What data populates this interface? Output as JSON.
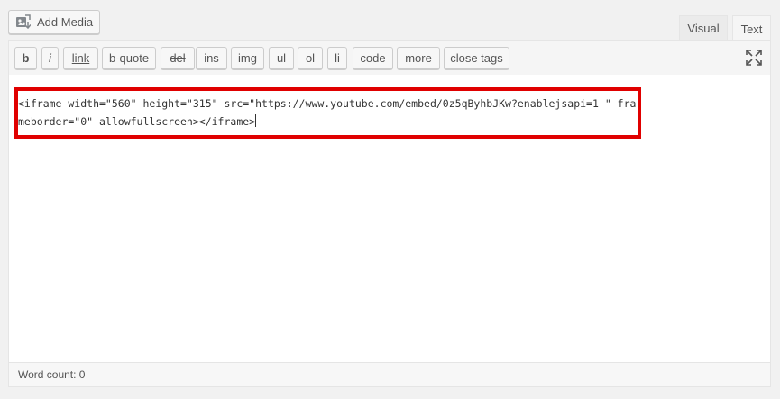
{
  "media": {
    "add_label": "Add Media"
  },
  "tabs": {
    "visual": "Visual",
    "text": "Text"
  },
  "toolbar": {
    "buttons": [
      "b",
      "i",
      "link",
      "b-quote",
      "del",
      "ins",
      "img",
      "ul",
      "ol",
      "li",
      "code",
      "more",
      "close tags"
    ]
  },
  "editor": {
    "content": "<iframe width=\"560\" height=\"315\" src=\"https://www.youtube.com/embed/0z5qByhbJKw?enablejsapi=1 \" frameborder=\"0\" allowfullscreen></iframe>"
  },
  "status": {
    "word_count": "Word count: 0"
  },
  "colors": {
    "highlight": "#e00000"
  }
}
